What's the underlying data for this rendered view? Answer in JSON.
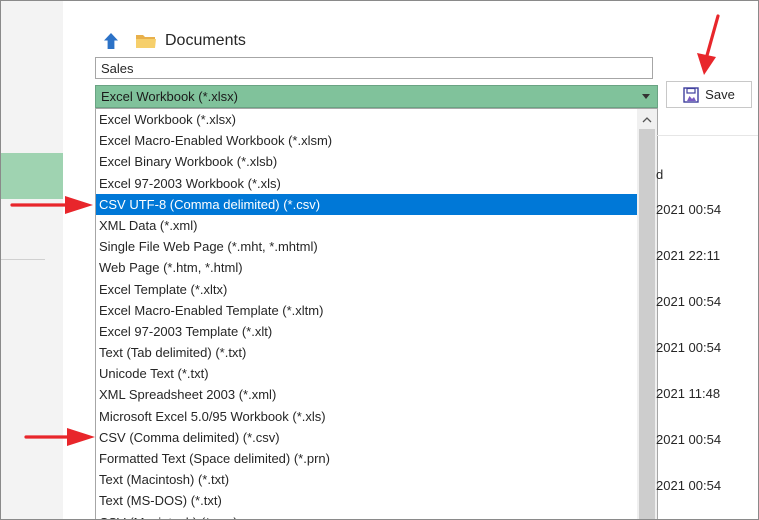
{
  "header": {
    "path": "Documents"
  },
  "filename": {
    "value": "Sales"
  },
  "save_type": {
    "selected": "Excel Workbook (*.xlsx)"
  },
  "save_button": {
    "label": "Save"
  },
  "dropdown": {
    "items": [
      "Excel Workbook (*.xlsx)",
      "Excel Macro-Enabled Workbook (*.xlsm)",
      "Excel Binary Workbook (*.xlsb)",
      "Excel 97-2003 Workbook (*.xls)",
      "CSV UTF-8 (Comma delimited) (*.csv)",
      "XML Data (*.xml)",
      "Single File Web Page (*.mht, *.mhtml)",
      "Web Page (*.htm, *.html)",
      "Excel Template (*.xltx)",
      "Excel Macro-Enabled Template (*.xltm)",
      "Excel 97-2003 Template (*.xlt)",
      "Text (Tab delimited) (*.txt)",
      "Unicode Text (*.txt)",
      "XML Spreadsheet 2003 (*.xml)",
      "Microsoft Excel 5.0/95 Workbook (*.xls)",
      "CSV (Comma delimited) (*.csv)",
      "Formatted Text (Space delimited) (*.prn)",
      "Text (Macintosh) (*.txt)",
      "Text (MS-DOS) (*.txt)",
      "CSV (Macintosh) (*.csv)"
    ]
  },
  "file_list": {
    "column_header": "d",
    "dates": [
      "2021 00:54",
      "2021 22:11",
      "2021 00:54",
      "2021 00:54",
      "2021 11:48",
      "2021 00:54",
      "2021 00:54"
    ]
  },
  "colors": {
    "accent_green": "#80c29b",
    "selection_blue": "#0078d7",
    "annotation_red": "#e8262b"
  },
  "icons": [
    "up-arrow-icon",
    "folder-icon",
    "save-icon",
    "chevron-down-icon",
    "scroll-up-icon"
  ]
}
